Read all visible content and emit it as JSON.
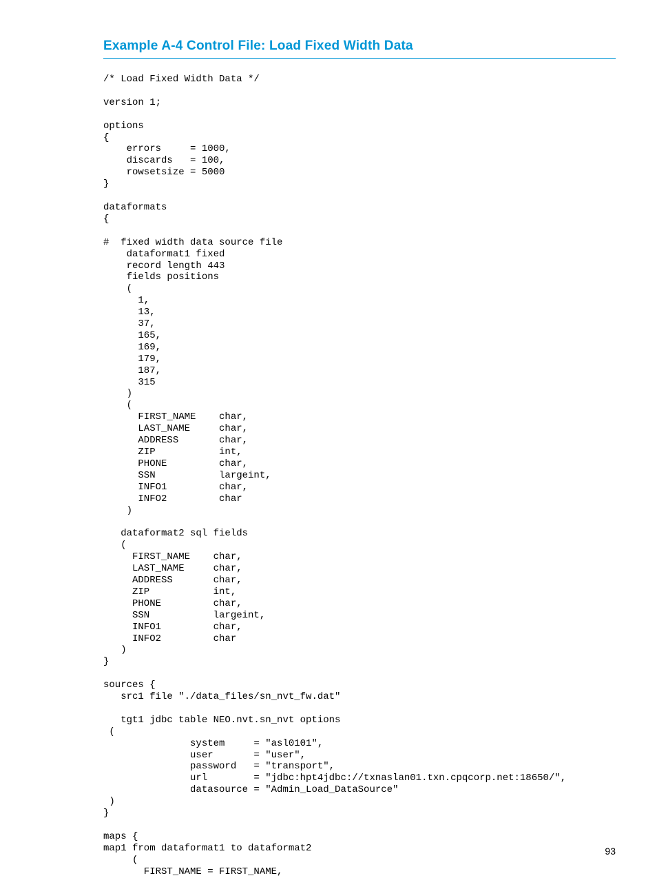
{
  "heading": "Example A-4 Control File: Load Fixed Width Data",
  "code": "/* Load Fixed Width Data */\n\nversion 1;\n\noptions\n{\n    errors     = 1000,\n    discards   = 100,\n    rowsetsize = 5000\n}\n\ndataformats\n{\n\n#  fixed width data source file\n    dataformat1 fixed\n    record length 443\n    fields positions\n    (\n      1,\n      13,\n      37,\n      165,\n      169,\n      179,\n      187,\n      315\n    )\n    (\n      FIRST_NAME    char,\n      LAST_NAME     char,\n      ADDRESS       char,\n      ZIP           int,\n      PHONE         char,\n      SSN           largeint,\n      INFO1         char,\n      INFO2         char\n    )\n\n   dataformat2 sql fields\n   (\n     FIRST_NAME    char,\n     LAST_NAME     char,\n     ADDRESS       char,\n     ZIP           int,\n     PHONE         char,\n     SSN           largeint,\n     INFO1         char,\n     INFO2         char\n   )\n}\n\nsources {\n   src1 file \"./data_files/sn_nvt_fw.dat\"\n\n   tgt1 jdbc table NEO.nvt.sn_nvt options\n (\n               system     = \"asl0101\",\n               user       = \"user\",\n               password   = \"transport\",\n               url        = \"jdbc:hpt4jdbc://txnaslan01.txn.cpqcorp.net:18650/\",\n               datasource = \"Admin_Load_DataSource\"\n )\n}\n\nmaps {\nmap1 from dataformat1 to dataformat2\n     (\n       FIRST_NAME = FIRST_NAME,",
  "page_number": "93"
}
